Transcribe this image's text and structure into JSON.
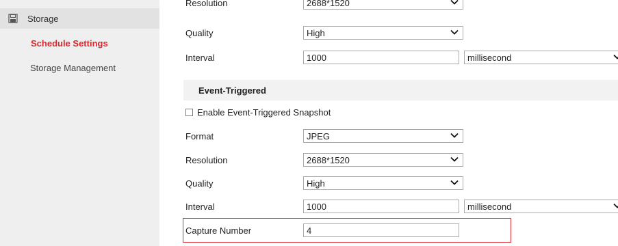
{
  "sidebar": {
    "parent_label": "Storage",
    "items": [
      {
        "label": "Schedule Settings",
        "active": true
      },
      {
        "label": "Storage Management",
        "active": false
      }
    ]
  },
  "timing": {
    "resolution": {
      "label": "Resolution",
      "value": "2688*1520"
    },
    "quality": {
      "label": "Quality",
      "value": "High"
    },
    "interval": {
      "label": "Interval",
      "value": "1000",
      "unit": "millisecond"
    }
  },
  "event_section": {
    "title": "Event-Triggered",
    "enable_label": "Enable Event-Triggered Snapshot",
    "enable_checked": false,
    "format": {
      "label": "Format",
      "value": "JPEG"
    },
    "resolution": {
      "label": "Resolution",
      "value": "2688*1520"
    },
    "quality": {
      "label": "Quality",
      "value": "High"
    },
    "interval": {
      "label": "Interval",
      "value": "1000",
      "unit": "millisecond"
    },
    "capture_number": {
      "label": "Capture Number",
      "value": "4"
    }
  },
  "colors": {
    "accent": "#d9282f",
    "sidebar_bg": "#efefef"
  }
}
